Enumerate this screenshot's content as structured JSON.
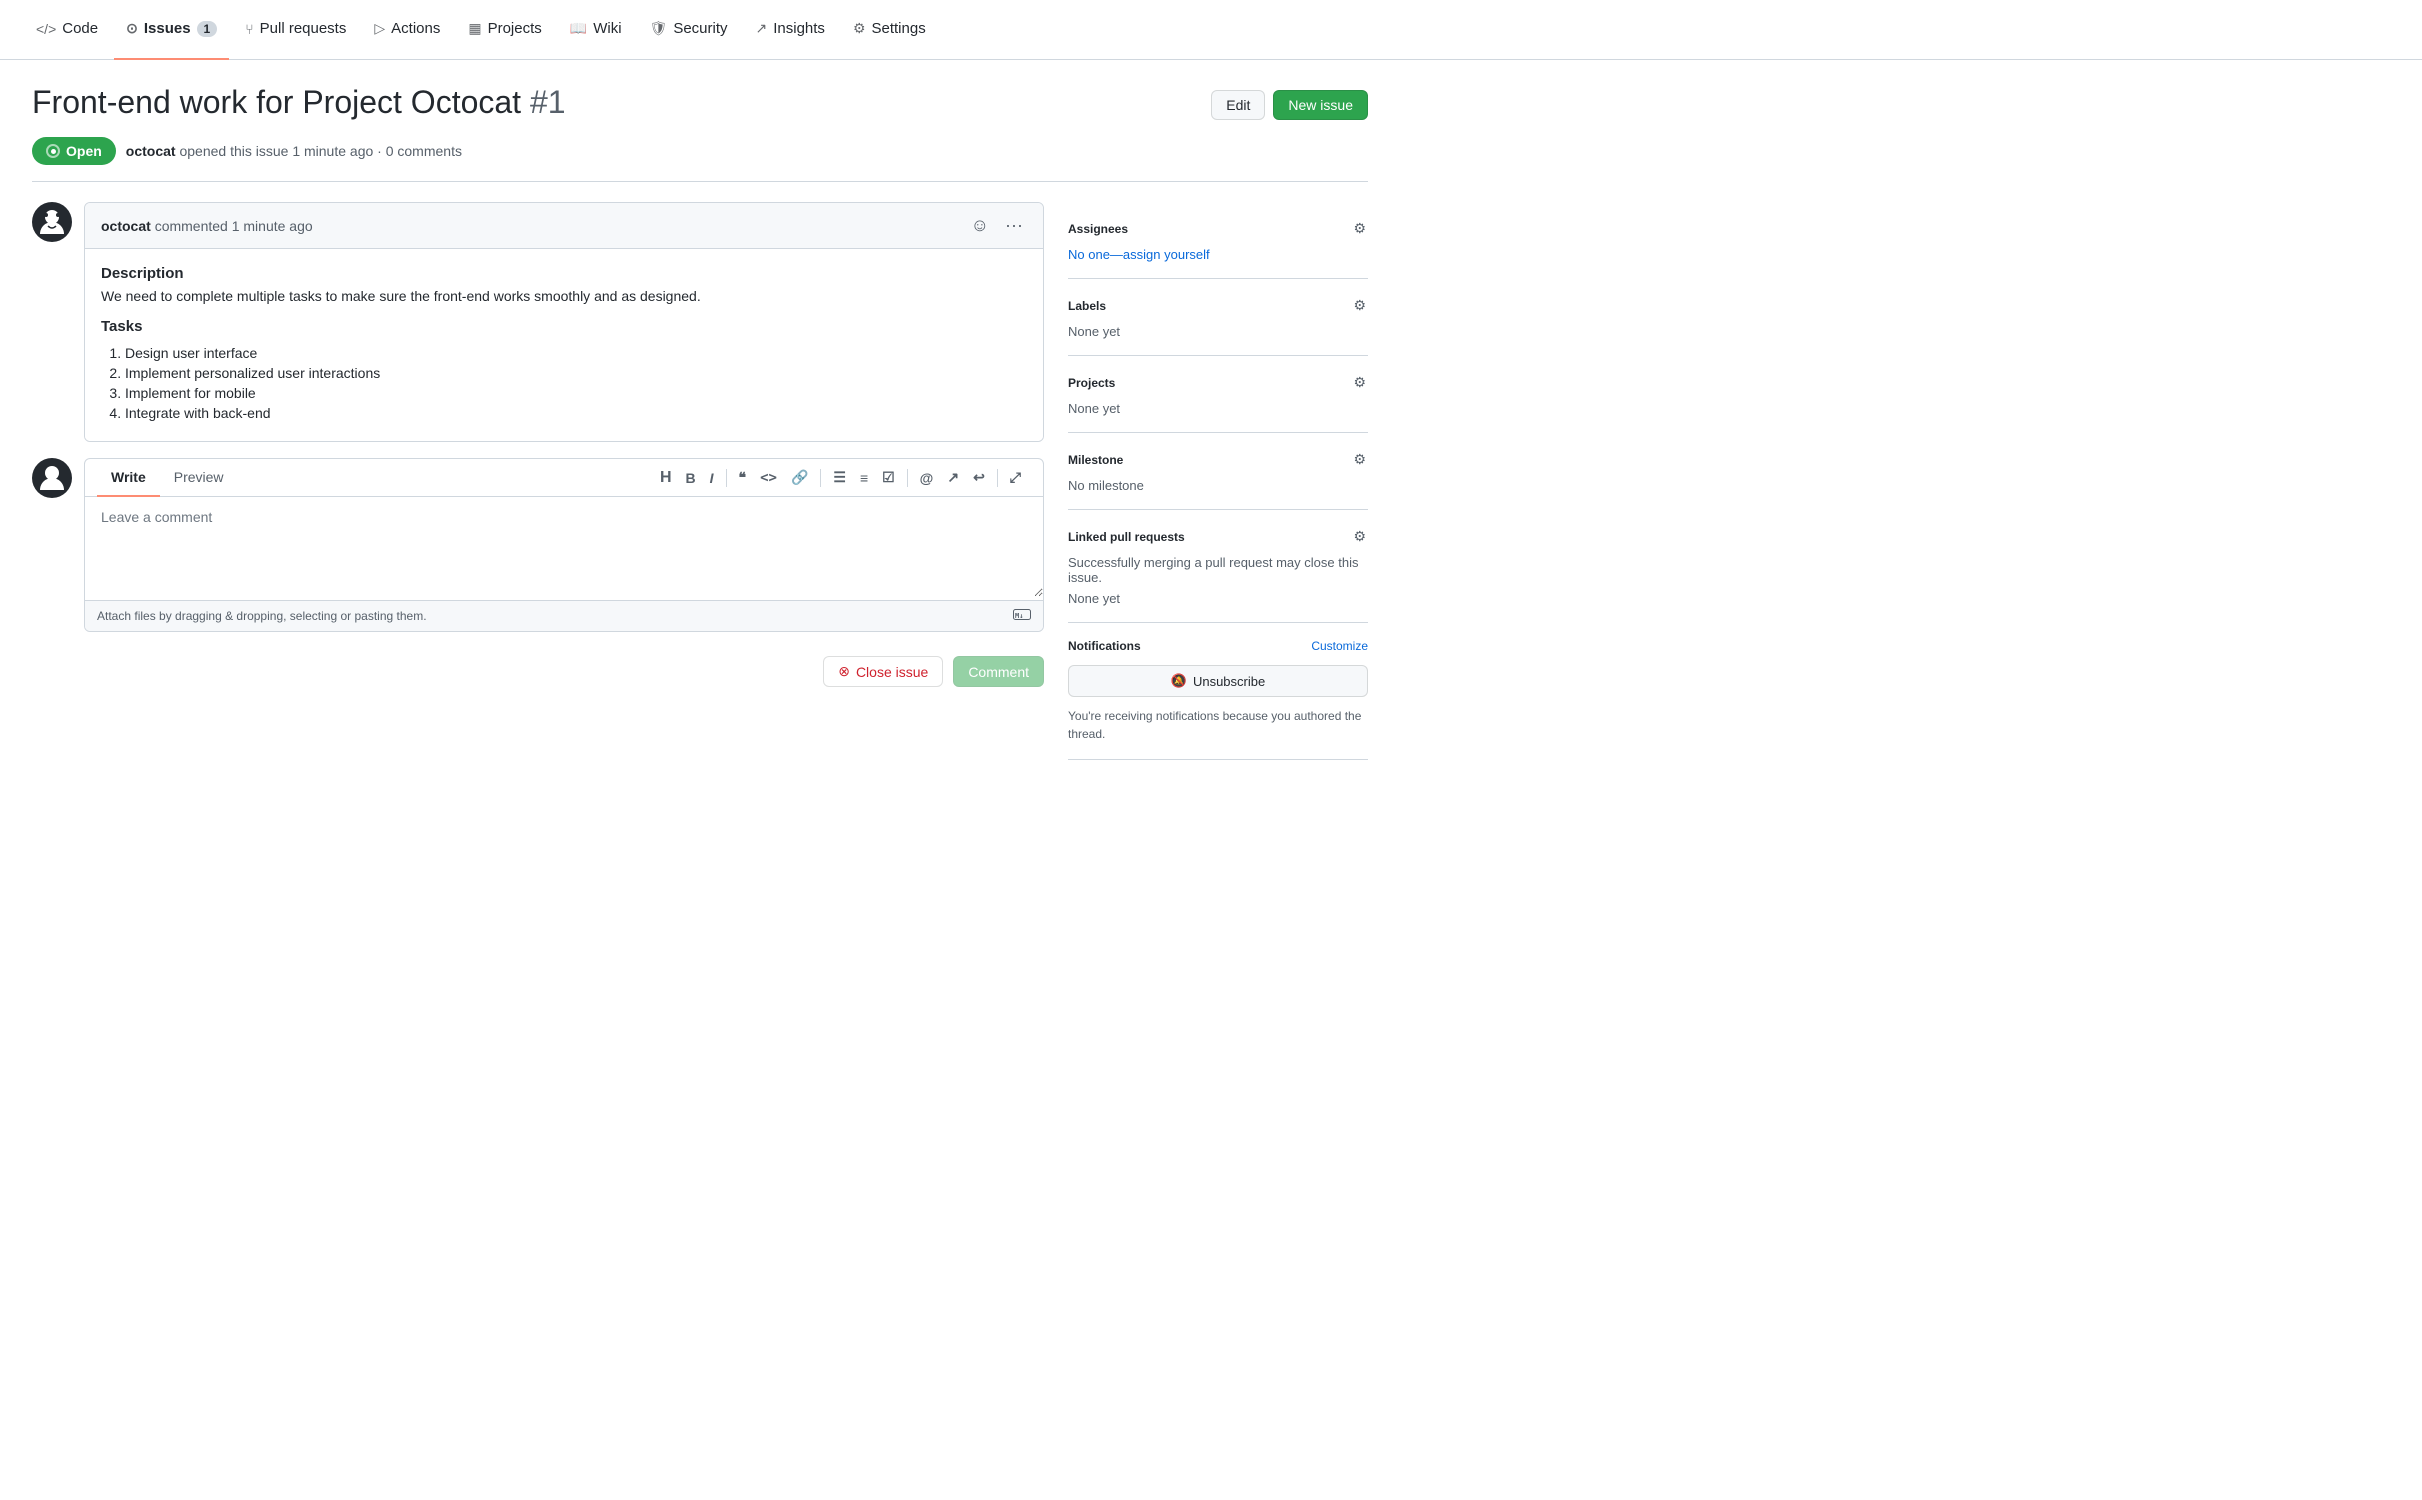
{
  "nav": {
    "items": [
      {
        "id": "code",
        "label": "Code",
        "icon": "<>",
        "active": false,
        "badge": null
      },
      {
        "id": "issues",
        "label": "Issues",
        "icon": "⊙",
        "active": true,
        "badge": "1"
      },
      {
        "id": "pull-requests",
        "label": "Pull requests",
        "icon": "⑂",
        "active": false,
        "badge": null
      },
      {
        "id": "actions",
        "label": "Actions",
        "icon": "▷",
        "active": false,
        "badge": null
      },
      {
        "id": "projects",
        "label": "Projects",
        "icon": "▦",
        "active": false,
        "badge": null
      },
      {
        "id": "wiki",
        "label": "Wiki",
        "icon": "📖",
        "active": false,
        "badge": null
      },
      {
        "id": "security",
        "label": "Security",
        "icon": "🛡",
        "active": false,
        "badge": null
      },
      {
        "id": "insights",
        "label": "Insights",
        "icon": "↗",
        "active": false,
        "badge": null
      },
      {
        "id": "settings",
        "label": "Settings",
        "icon": "⚙",
        "active": false,
        "badge": null
      }
    ]
  },
  "issue": {
    "title": "Front-end work for Project Octocat",
    "number": "#1",
    "status": "Open",
    "author": "octocat",
    "opened_text": "opened this issue 1 minute ago · 0 comments"
  },
  "header_buttons": {
    "edit_label": "Edit",
    "new_issue_label": "New issue"
  },
  "comment": {
    "author": "octocat",
    "time": "commented 1 minute ago",
    "description_heading": "Description",
    "description_text": "We need to complete multiple tasks to make sure the front-end works smoothly and as designed.",
    "tasks_heading": "Tasks",
    "tasks": [
      "Design user interface",
      "Implement personalized user interactions",
      "Implement for mobile",
      "Integrate with back-end"
    ]
  },
  "reply": {
    "write_tab": "Write",
    "preview_tab": "Preview",
    "placeholder": "Leave a comment",
    "attach_text": "Attach files by dragging & dropping, selecting or pasting them.",
    "toolbar": {
      "heading": "H",
      "bold": "B",
      "italic": "I",
      "quote": "❝",
      "code": "<>",
      "link": "🔗",
      "bullet": "☰",
      "numbered": "☰",
      "task": "☑",
      "mention": "@",
      "reference": "↗",
      "undo": "↩"
    }
  },
  "action_buttons": {
    "close_issue": "Close issue",
    "comment": "Comment"
  },
  "sidebar": {
    "assignees": {
      "title": "Assignees",
      "value": "No one—assign yourself"
    },
    "labels": {
      "title": "Labels",
      "value": "None yet"
    },
    "projects": {
      "title": "Projects",
      "value": "None yet"
    },
    "milestone": {
      "title": "Milestone",
      "value": "No milestone"
    },
    "linked_pr": {
      "title": "Linked pull requests",
      "description": "Successfully merging a pull request may close this issue.",
      "value": "None yet"
    },
    "notifications": {
      "title": "Notifications",
      "customize_label": "Customize",
      "unsubscribe_label": "Unsubscribe",
      "note": "You're receiving notifications because you authored the thread."
    }
  },
  "colors": {
    "accent_green": "#2da44e",
    "nav_active_underline": "#fd8c73",
    "link_blue": "#0969da"
  }
}
